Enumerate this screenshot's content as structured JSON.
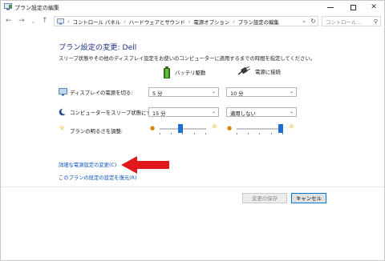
{
  "window": {
    "title": "プラン設定の編集"
  },
  "nav": {
    "breadcrumbs": [
      "コントロール パネル",
      "ハードウェアとサウンド",
      "電源オプション",
      "プラン設定の編集"
    ],
    "search_placeholder": "コントロール..."
  },
  "main": {
    "heading": "プラン設定の変更: Dell",
    "description": "スリープ状態やその他のディスプレイ設定をお使いのコンピューターに適用するまでの時間を指定してください。",
    "columns": {
      "battery": "バッテリ駆動",
      "plugged": "電源に接続"
    },
    "rows": {
      "display": {
        "label": "ディスプレイの電源を切る:",
        "battery": "5 分",
        "plugged": "10 分"
      },
      "sleep": {
        "label": "コンピューターをスリープ状態にする:",
        "battery": "15 分",
        "plugged": "適用しない"
      },
      "brightness": {
        "label": "プランの明るさを調整:",
        "battery_level": 0.45,
        "plugged_level": 1.0
      }
    },
    "links": {
      "advanced": "詳細な電源設定の変更(C)",
      "restore": "このプランの既定の設定を復元(R)"
    }
  },
  "footer": {
    "save_label": "変更の保存",
    "cancel_label": "キャンセル"
  },
  "colors": {
    "heading": "#1e3287",
    "link": "#0b55c4",
    "annotation_arrow": "#e0181b",
    "slider_thumb": "#1e6fd4"
  }
}
